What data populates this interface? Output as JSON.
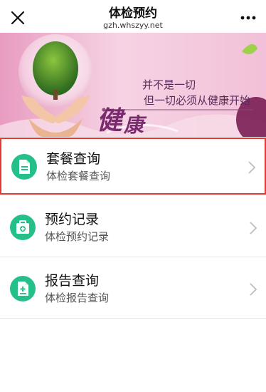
{
  "header": {
    "title": "体检预约",
    "domain": "gzh.whszyy.net"
  },
  "banner": {
    "slogan_char_1": "健",
    "slogan_char_2": "康",
    "slogan_line_1": "并不是一切",
    "slogan_line_2": "但一切必须从健康开始"
  },
  "menu": {
    "items": [
      {
        "title": "套餐查询",
        "desc": "体检套餐查询",
        "icon": "document-icon",
        "selected": true
      },
      {
        "title": "预约记录",
        "desc": "体检预约记录",
        "icon": "medical-kit-icon",
        "selected": false
      },
      {
        "title": "报告查询",
        "desc": "体检报告查询",
        "icon": "report-plus-icon",
        "selected": false
      }
    ]
  },
  "colors": {
    "accent_green": "#25c08a",
    "selection_red": "#e53935",
    "banner_pink": "#f3c6dc"
  }
}
